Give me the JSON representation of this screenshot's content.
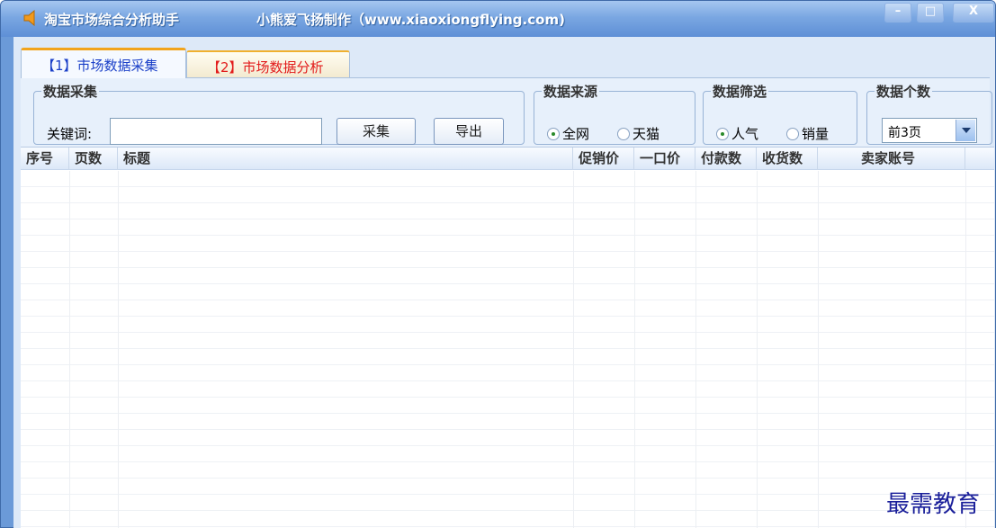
{
  "window": {
    "title": "淘宝市场综合分析助手",
    "credit": "小熊爱飞扬制作（www.xiaoxiongflying.com)",
    "icon": "speaker-icon",
    "controls": {
      "minimize": "–",
      "maximize": "□",
      "close": "X"
    }
  },
  "tabs": [
    {
      "label": "【1】市场数据采集",
      "active": true
    },
    {
      "label": "【2】市场数据分析",
      "active": false
    }
  ],
  "collect": {
    "legend": "数据采集",
    "keyword_label": "关键词:",
    "keyword_value": "",
    "collect_button": "采集",
    "export_button": "导出"
  },
  "source": {
    "legend": "数据来源",
    "options": [
      {
        "label": "全网",
        "selected": true
      },
      {
        "label": "天猫",
        "selected": false
      }
    ]
  },
  "filter": {
    "legend": "数据筛选",
    "options": [
      {
        "label": "人气",
        "selected": true
      },
      {
        "label": "销量",
        "selected": false
      }
    ]
  },
  "count": {
    "legend": "数据个数",
    "selected": "前3页"
  },
  "table": {
    "columns": [
      "序号",
      "页数",
      "标题",
      "促销价",
      "一口价",
      "付款数",
      "收货数",
      "卖家账号"
    ],
    "rows": []
  },
  "watermark": "最需教育",
  "colors": {
    "title_bar": "#7aa7e2",
    "tab_active_text": "#1a3fc8",
    "tab_inactive_text": "#e21b1b",
    "tab_accent": "#f2a41c",
    "watermark": "#1a1f9a"
  }
}
